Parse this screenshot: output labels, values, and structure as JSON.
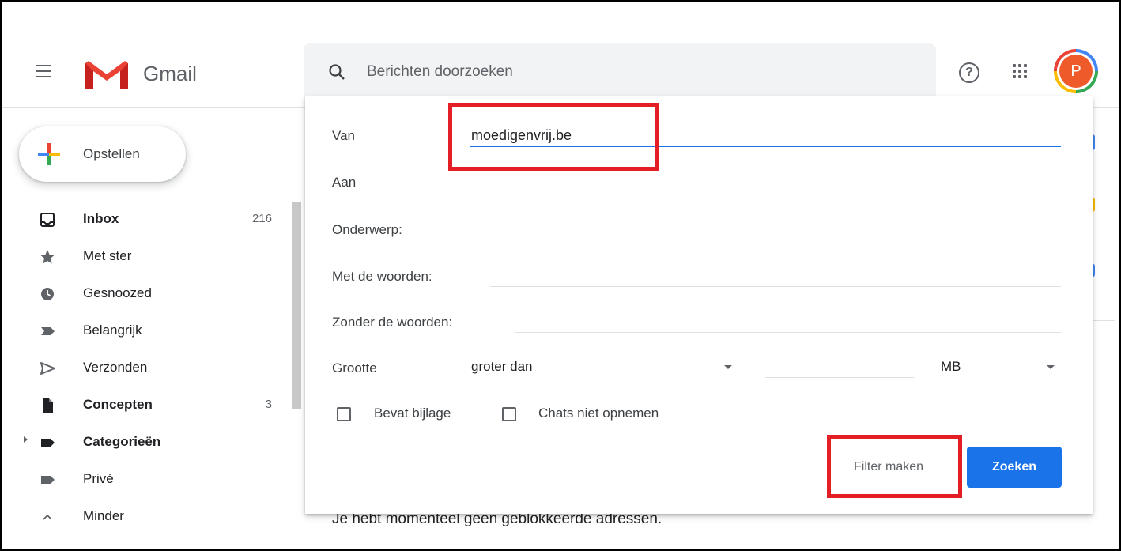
{
  "app": {
    "logo_text": "Gmail",
    "search_placeholder": "Berichten doorzoeken"
  },
  "user": {
    "avatar_letter": "P",
    "avatar_color": "#ef5a2a"
  },
  "header": {
    "help_glyph": "?"
  },
  "compose": {
    "label": "Opstellen"
  },
  "sidebar": {
    "items": [
      {
        "label": "Inbox",
        "count": "216",
        "icon": "inbox-icon",
        "bold": true
      },
      {
        "label": "Met ster",
        "count": "",
        "icon": "star-icon",
        "bold": false
      },
      {
        "label": "Gesnoozed",
        "count": "",
        "icon": "clock-icon",
        "bold": false
      },
      {
        "label": "Belangrijk",
        "count": "",
        "icon": "important-icon",
        "bold": false
      },
      {
        "label": "Verzonden",
        "count": "",
        "icon": "send-icon",
        "bold": false
      },
      {
        "label": "Concepten",
        "count": "3",
        "icon": "draft-icon",
        "bold": true
      },
      {
        "label": "Categorieën",
        "count": "",
        "icon": "label-icon",
        "bold": true
      },
      {
        "label": "Privé",
        "count": "",
        "icon": "label-icon",
        "bold": false
      },
      {
        "label": "Minder",
        "count": "",
        "icon": "chevron-up-icon",
        "bold": false
      }
    ]
  },
  "search_options": {
    "from_label": "Van",
    "from_value": "moedigenvrij.be",
    "to_label": "Aan",
    "subject_label": "Onderwerp:",
    "has_words_label": "Met de woorden:",
    "without_words_label": "Zonder de woorden:",
    "size_label": "Grootte",
    "size_operator": "groter dan",
    "size_unit": "MB",
    "has_attachment_label": "Bevat bijlage",
    "exclude_chats_label": "Chats niet opnemen",
    "create_filter_label": "Filter maken",
    "search_button_label": "Zoeken"
  },
  "background_text": "Je hebt momenteel geen geblokkeerde adressen.",
  "colors": {
    "primary_button": "#1a73e8",
    "annotation_red": "#e31e24",
    "gmail_red": "#ea4335"
  }
}
